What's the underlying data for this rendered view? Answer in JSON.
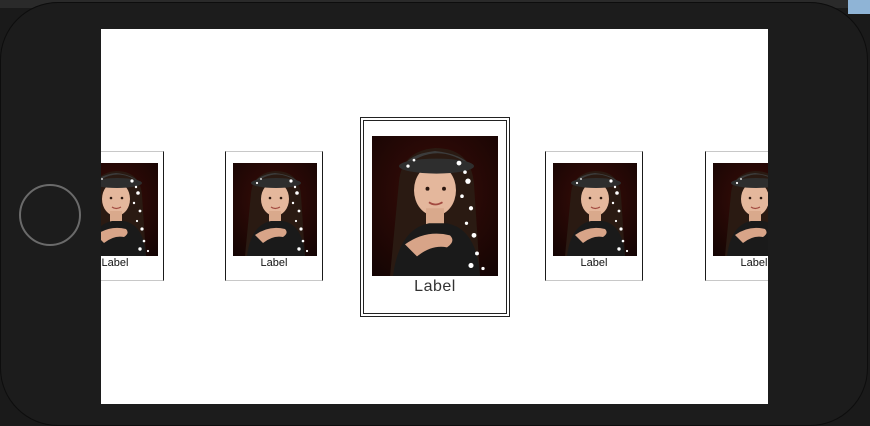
{
  "colors": {
    "device_body": "#1c1c1c",
    "screen_background": "#ffffff",
    "card_border": "#1a1a1a"
  },
  "carousel": {
    "items": [
      {
        "label": "Label",
        "image": "portrait-photo"
      },
      {
        "label": "Label",
        "image": "portrait-photo"
      },
      {
        "label": "Label",
        "image": "portrait-photo"
      },
      {
        "label": "Label",
        "image": "portrait-photo"
      },
      {
        "label": "Label",
        "image": "portrait-photo"
      }
    ],
    "selected_index": 2
  }
}
